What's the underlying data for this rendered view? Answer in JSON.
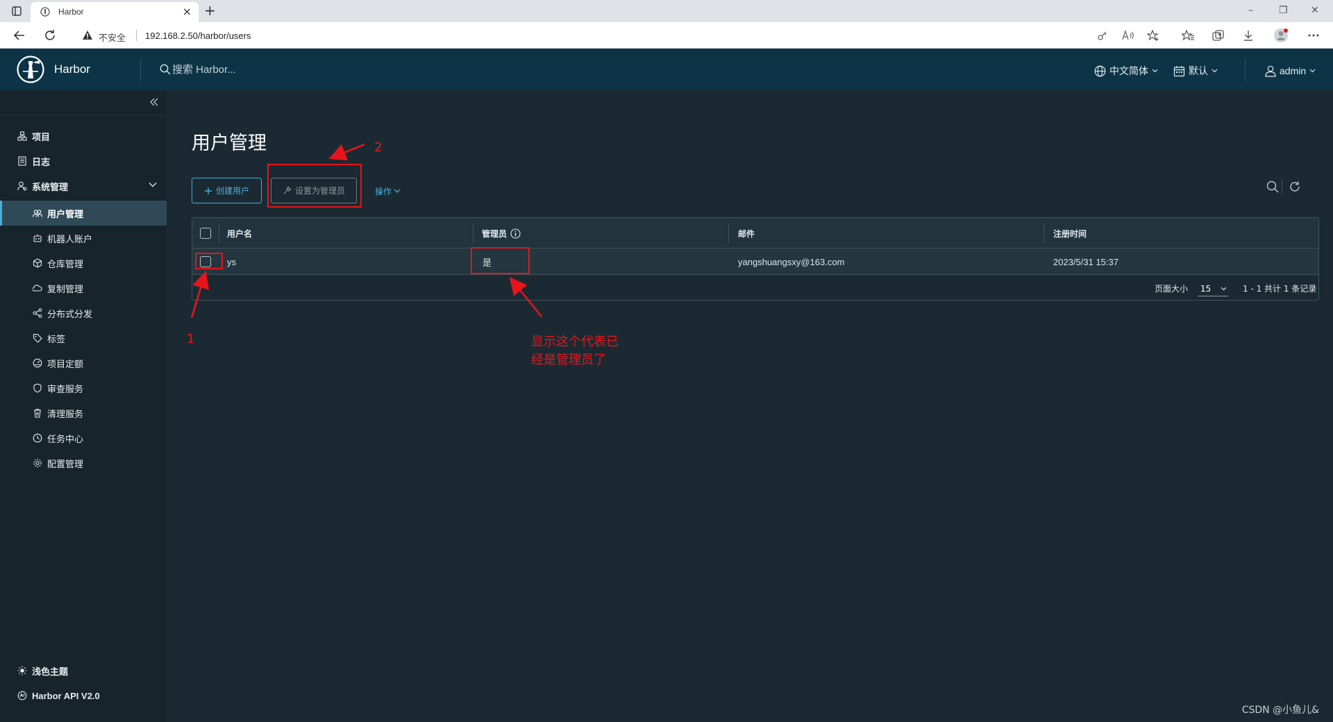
{
  "browser": {
    "tab_title": "Harbor",
    "tab_close": "×",
    "new_tab": "+",
    "insecure_label": "不安全",
    "url": "192.168.2.50/harbor/users",
    "win_min": "–",
    "win_restore": "❐",
    "win_close": "✕"
  },
  "header": {
    "brand": "Harbor",
    "search_placeholder": "搜索 Harbor...",
    "language": "中文简体",
    "date_format": "默认",
    "user": "admin"
  },
  "sidebar": {
    "items": [
      {
        "label": "项目",
        "icon": "projects-icon"
      },
      {
        "label": "日志",
        "icon": "logs-icon"
      },
      {
        "label": "系统管理",
        "icon": "system-admin-icon"
      }
    ],
    "sub_items": [
      {
        "label": "用户管理",
        "icon": "users-icon"
      },
      {
        "label": "机器人账户",
        "icon": "robot-icon"
      },
      {
        "label": "仓库管理",
        "icon": "registry-icon"
      },
      {
        "label": "复制管理",
        "icon": "replication-icon"
      },
      {
        "label": "分布式分发",
        "icon": "distribution-icon"
      },
      {
        "label": "标签",
        "icon": "label-icon"
      },
      {
        "label": "项目定额",
        "icon": "quota-icon"
      },
      {
        "label": "审查服务",
        "icon": "scanner-icon"
      },
      {
        "label": "清理服务",
        "icon": "gc-icon"
      },
      {
        "label": "任务中心",
        "icon": "jobs-icon"
      },
      {
        "label": "配置管理",
        "icon": "config-icon"
      }
    ],
    "bottom": [
      {
        "label": "浅色主题",
        "icon": "sun-icon"
      },
      {
        "label": "Harbor API V2.0",
        "icon": "api-icon"
      }
    ]
  },
  "main": {
    "title": "用户管理",
    "create_user": "创建用户",
    "set_admin": "设置为管理员",
    "actions": "操作",
    "columns": [
      "用户名",
      "管理员",
      "邮件",
      "注册时间"
    ],
    "rows": [
      {
        "username": "ys",
        "admin": "是",
        "email": "yangshuangsxy@163.com",
        "created": "2023/5/31 15:37"
      }
    ],
    "page_size_label": "页面大小",
    "page_size": "15",
    "summary": "1 - 1 共计 1 条记录"
  },
  "annotations": {
    "label_1": "1",
    "label_2": "2",
    "note_line1": "显示这个代表已",
    "note_line2": "经是管理员了"
  },
  "watermark": "CSDN @小鱼儿&",
  "colors": {
    "header_bg": "#0c3446",
    "content_bg": "#1b2a32",
    "sidebar_bg": "#17242b",
    "accent": "#49aeda",
    "annotation": "#e8141c"
  }
}
